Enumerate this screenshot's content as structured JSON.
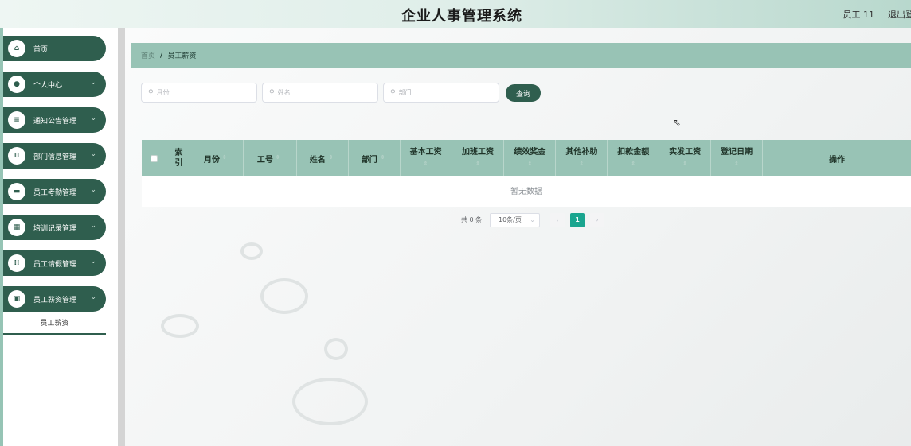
{
  "header": {
    "title": "企业人事管理系统",
    "user": "员工 11",
    "logout": "退出登"
  },
  "sidebar": {
    "items": [
      {
        "label": "首页",
        "icon": "home-icon",
        "glyph": "⌂",
        "has_children": false
      },
      {
        "label": "个人中心",
        "icon": "user-icon",
        "glyph": "●",
        "has_children": true
      },
      {
        "label": "通知公告管理",
        "icon": "list-icon",
        "glyph": "≡",
        "has_children": true
      },
      {
        "label": "部门信息管理",
        "icon": "grid-icon",
        "glyph": "⁞⁞",
        "has_children": true
      },
      {
        "label": "员工考勤管理",
        "icon": "ticket-icon",
        "glyph": "▬",
        "has_children": true
      },
      {
        "label": "培训记录管理",
        "icon": "table-icon",
        "glyph": "▦",
        "has_children": true
      },
      {
        "label": "员工请假管理",
        "icon": "apps-icon",
        "glyph": "⁞⁞",
        "has_children": true
      },
      {
        "label": "员工薪资管理",
        "icon": "briefcase-icon",
        "glyph": "▣",
        "has_children": true
      }
    ],
    "submenu": "员工薪资"
  },
  "breadcrumb": {
    "home": "首页",
    "separator": "/",
    "current": "员工薪资"
  },
  "search": {
    "month_placeholder": "月份",
    "name_placeholder": "姓名",
    "dept_placeholder": "部门",
    "query_label": "查询"
  },
  "table": {
    "columns": [
      "索引",
      "月份",
      "工号",
      "姓名",
      "部门",
      "基本工资",
      "加班工资",
      "绩效奖金",
      "其他补助",
      "扣款金额",
      "实发工资",
      "登记日期",
      "操作"
    ],
    "empty_text": "暂无数据"
  },
  "pagination": {
    "total": "共 0 条",
    "page_size": "10条/页",
    "prev": "‹",
    "current_page": "1",
    "next": "›"
  },
  "colors": {
    "accent_dark": "#2f5e4e",
    "accent_light": "#98c3b5",
    "page_active": "#1aa58f"
  }
}
